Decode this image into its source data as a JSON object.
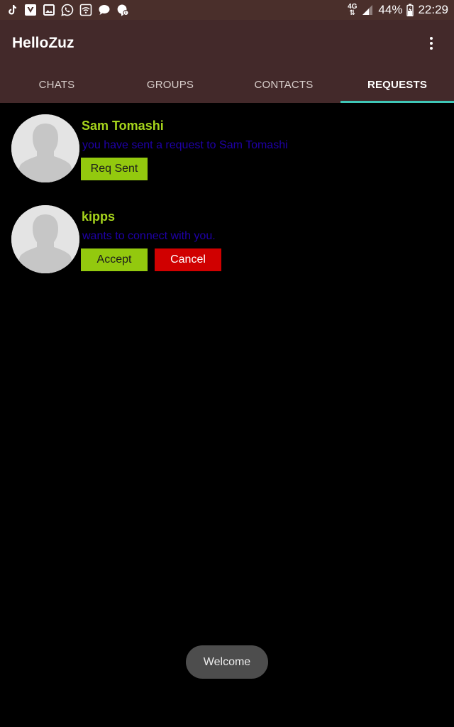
{
  "status_bar": {
    "icons": [
      "tiktok-icon",
      "vivaldi-icon",
      "gallery-icon",
      "whatsapp-icon",
      "wifi-icon",
      "chat-bubble-icon",
      "hangouts-icon"
    ],
    "network": "4G",
    "battery_percent": "44%",
    "time": "22:29"
  },
  "app_bar": {
    "title": "HelloZuz"
  },
  "tabs": [
    {
      "label": "CHATS",
      "active": false
    },
    {
      "label": "GROUPS",
      "active": false
    },
    {
      "label": "CONTACTS",
      "active": false
    },
    {
      "label": "REQUESTS",
      "active": true
    }
  ],
  "requests": [
    {
      "name": "Sam Tomashi",
      "message": "you have sent a request to Sam Tomashi",
      "primary_label": "Req Sent"
    },
    {
      "name": "kipps",
      "message": "wants to connect with you.",
      "primary_label": "Accept",
      "secondary_label": "Cancel"
    }
  ],
  "toast": {
    "text": "Welcome"
  },
  "colors": {
    "status_bar": "#4a2f2b",
    "app_bar": "#43292a",
    "tab_indicator": "#3fc7b7",
    "name_text": "#a6d41c",
    "message_text": "#1f00a8",
    "green_button": "#93c90e",
    "red_button": "#d00000"
  }
}
